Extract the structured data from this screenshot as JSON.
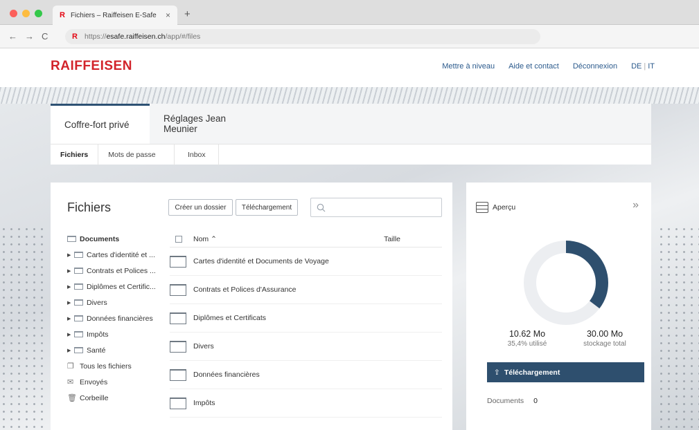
{
  "browser": {
    "tab_title": "Fichiers – Raiffeisen E-Safe",
    "tab_close": "×",
    "new_tab": "+",
    "favicon": "R",
    "url_prefix": "https://",
    "url_host": "esafe.raiffeisen.ch",
    "url_path": "/app/#/files",
    "nav": {
      "back": "←",
      "forward": "→",
      "reload": "C"
    }
  },
  "header": {
    "logo": "RAIFFEISEN",
    "links": [
      "Mettre à niveau",
      "Aide et contact",
      "Déconnexion"
    ],
    "lang_de": "DE",
    "lang_sep": "|",
    "lang_it": "IT"
  },
  "main_tabs": [
    "Coffre-fort privé",
    "Réglages Jean Meunier"
  ],
  "sub_tabs": [
    "Fichiers",
    "Mots de passe",
    "Inbox"
  ],
  "files": {
    "title": "Fichiers",
    "create_folder_label": "Créer un dossier",
    "upload_label": "Téléchargement",
    "search_icon": "search-icon",
    "tree": {
      "root": "Documents",
      "children": [
        "Cartes d'identité et ...",
        "Contrats et Polices ...",
        "Diplômes et Certific...",
        "Divers",
        "Données financières",
        "Impôts",
        "Santé"
      ],
      "special": [
        "Tous les fichiers",
        "Envoyés",
        "Corbeille"
      ]
    },
    "columns": {
      "name": "Nom ⌃",
      "size": "Taille"
    },
    "rows": [
      "Cartes d'identité et Documents de Voyage",
      "Contrats et Polices d'Assurance",
      "Diplômes et Certificats",
      "Divers",
      "Données financières",
      "Impôts"
    ]
  },
  "overview": {
    "title": "Aperçu",
    "expand": "»",
    "used_value": "10.62 Mo",
    "used_label": "35,4% utilisé",
    "total_value": "30.00 Mo",
    "total_label": "stockage total",
    "used_fraction": 0.354,
    "upload_label": "Téléchargement",
    "documents_label": "Documents",
    "documents_count": "0"
  },
  "colors": {
    "brand_red": "#d2232a",
    "accent_navy": "#2e4f6e",
    "link_blue": "#2b5a8c"
  }
}
